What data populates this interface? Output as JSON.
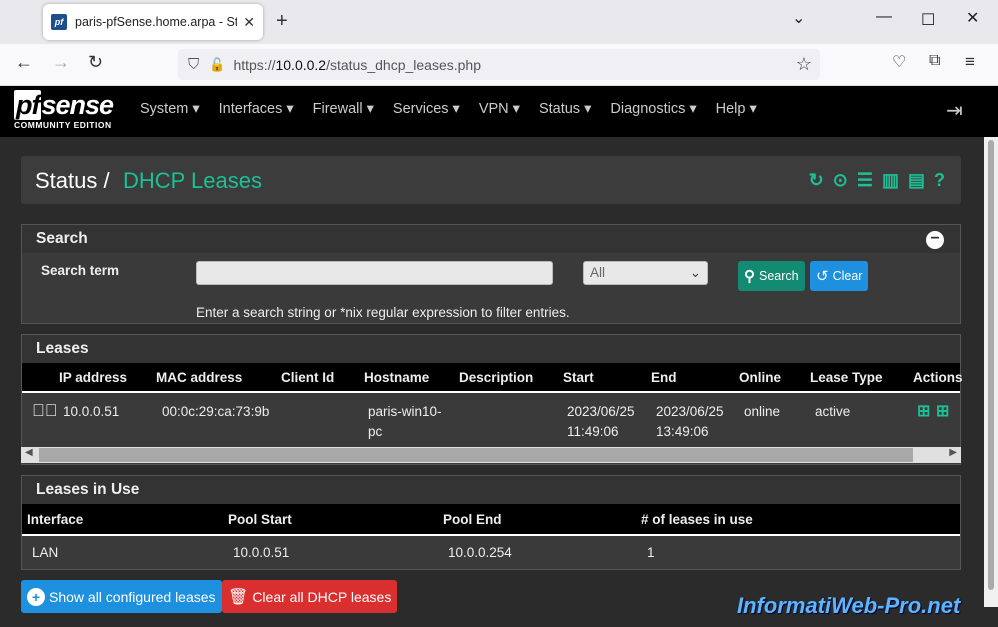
{
  "browser": {
    "tab_title": "paris-pfSense.home.arpa - Status",
    "favicon_text": "pf",
    "url_prefix": "https://",
    "url_host": "10.0.0.2",
    "url_path": "/status_dhcp_leases.php"
  },
  "logo": {
    "main_a": "pf",
    "main_b": "sense",
    "sub": "COMMUNITY EDITION"
  },
  "menu": [
    "System ▾",
    "Interfaces ▾",
    "Firewall ▾",
    "Services ▾",
    "VPN ▾",
    "Status ▾",
    "Diagnostics ▾",
    "Help ▾"
  ],
  "breadcrumb": {
    "parent": "Status /",
    "current": "DHCP Leases"
  },
  "search": {
    "title": "Search",
    "term_label": "Search term",
    "term_value": "",
    "select_value": "All",
    "search_button": "Search",
    "clear_button": "Clear",
    "help_text": "Enter a search string or *nix regular expression to filter entries."
  },
  "leases": {
    "title": "Leases",
    "columns": [
      "IP address",
      "MAC address",
      "Client Id",
      "Hostname",
      "Description",
      "Start",
      "End",
      "Online",
      "Lease Type",
      "Actions"
    ],
    "rows": [
      {
        "ip": "10.0.0.51",
        "mac": "00:0c:29:ca:73:9b",
        "client_id": "",
        "hostname_1": "paris-win10-",
        "hostname_2": "pc",
        "description": "",
        "start_date": "2023/06/25",
        "start_time": "11:49:06",
        "end_date": "2023/06/25",
        "end_time": "13:49:06",
        "online": "online",
        "type": "active"
      }
    ]
  },
  "in_use": {
    "title": "Leases in Use",
    "columns": [
      "Interface",
      "Pool Start",
      "Pool End",
      "# of leases in use"
    ],
    "rows": [
      {
        "interface": "LAN",
        "pool_start": "10.0.0.51",
        "pool_end": "10.0.0.254",
        "count": "1"
      }
    ]
  },
  "footer_buttons": {
    "show_all": "Show all configured leases",
    "clear_all": "Clear all DHCP leases"
  },
  "watermark": "InformatiWeb-Pro.net",
  "colors": {
    "accent": "#1dbf96",
    "primary": "#1e90e0",
    "danger": "#d9302f",
    "success": "#138a72"
  }
}
